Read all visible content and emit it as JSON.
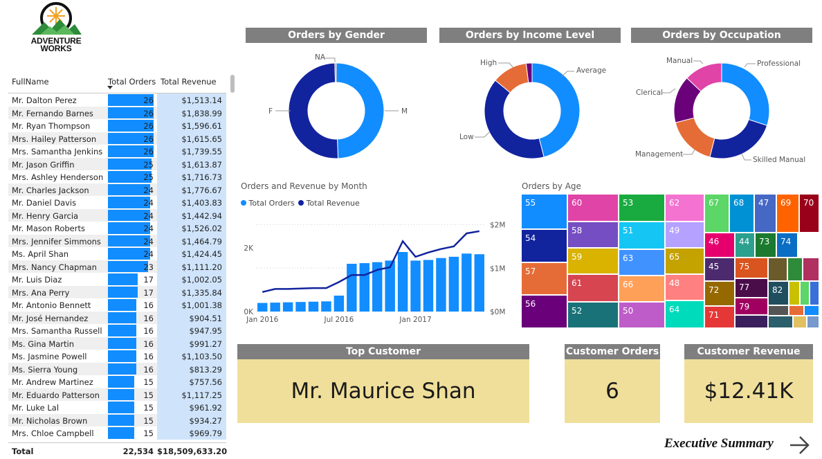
{
  "logo": {
    "line1": "ADVENTURE",
    "line2": "WORKS"
  },
  "table": {
    "headers": {
      "name": "FullName",
      "orders": "Total Orders",
      "revenue": "Total Revenue"
    },
    "max_orders": 26,
    "rows": [
      {
        "name": "Mr. Dalton Perez",
        "orders": 26,
        "revenue": "$1,513.14"
      },
      {
        "name": "Mr. Fernando Barnes",
        "orders": 26,
        "revenue": "$1,838.99"
      },
      {
        "name": "Mr. Ryan Thompson",
        "orders": 26,
        "revenue": "$1,596.61"
      },
      {
        "name": "Mrs. Hailey Patterson",
        "orders": 26,
        "revenue": "$1,615.65"
      },
      {
        "name": "Mrs. Samantha Jenkins",
        "orders": 26,
        "revenue": "$1,739.55"
      },
      {
        "name": "Mr. Jason Griffin",
        "orders": 25,
        "revenue": "$1,613.87"
      },
      {
        "name": "Mrs. Ashley Henderson",
        "orders": 25,
        "revenue": "$1,716.73"
      },
      {
        "name": "Mr. Charles Jackson",
        "orders": 24,
        "revenue": "$1,776.67"
      },
      {
        "name": "Mr. Daniel Davis",
        "orders": 24,
        "revenue": "$1,403.83"
      },
      {
        "name": "Mr. Henry Garcia",
        "orders": 24,
        "revenue": "$1,442.94"
      },
      {
        "name": "Mr. Mason Roberts",
        "orders": 24,
        "revenue": "$1,526.02"
      },
      {
        "name": "Mrs. Jennifer Simmons",
        "orders": 24,
        "revenue": "$1,464.79"
      },
      {
        "name": "Ms. April Shan",
        "orders": 24,
        "revenue": "$1,424.45"
      },
      {
        "name": "Mrs. Nancy Chapman",
        "orders": 23,
        "revenue": "$1,111.20"
      },
      {
        "name": "Mr. Luis Diaz",
        "orders": 17,
        "revenue": "$1,002.05"
      },
      {
        "name": "Mrs. Ana Perry",
        "orders": 17,
        "revenue": "$1,335.84"
      },
      {
        "name": "Mr. Antonio Bennett",
        "orders": 16,
        "revenue": "$1,001.38"
      },
      {
        "name": "Mr. José Hernandez",
        "orders": 16,
        "revenue": "$904.51"
      },
      {
        "name": "Mrs. Samantha Russell",
        "orders": 16,
        "revenue": "$947.95"
      },
      {
        "name": "Ms. Gina Martin",
        "orders": 16,
        "revenue": "$991.27"
      },
      {
        "name": "Ms. Jasmine Powell",
        "orders": 16,
        "revenue": "$1,103.50"
      },
      {
        "name": "Ms. Sierra Young",
        "orders": 16,
        "revenue": "$813.29"
      },
      {
        "name": "Mr. Andrew Martinez",
        "orders": 15,
        "revenue": "$757.56"
      },
      {
        "name": "Mr. Eduardo Patterson",
        "orders": 15,
        "revenue": "$1,117.25"
      },
      {
        "name": "Mr. Luke Lal",
        "orders": 15,
        "revenue": "$961.92"
      },
      {
        "name": "Mr. Nicholas Brown",
        "orders": 15,
        "revenue": "$934.27"
      },
      {
        "name": "Mrs. Chloe Campbell",
        "orders": 15,
        "revenue": "$969.79"
      }
    ],
    "total": {
      "label": "Total",
      "orders": "22,534",
      "revenue": "$18,509,633.20"
    }
  },
  "gender": {
    "title": "Orders by Gender",
    "labels": {
      "na": "NA",
      "f": "F",
      "m": "M"
    }
  },
  "income": {
    "title": "Orders by Income Level",
    "labels": {
      "high": "High",
      "average": "Average",
      "low": "Low"
    }
  },
  "occupation": {
    "title": "Orders by Occupation",
    "labels": {
      "manual": "Manual",
      "professional": "Professional",
      "clerical": "Clerical",
      "management": "Management",
      "skilled": "Skilled Manual"
    }
  },
  "colors": {
    "primary": "#118dff",
    "navy": "#12239e",
    "orange": "#e66c37",
    "purple": "#6b007b",
    "pink": "#e044a7",
    "red": "#d64550"
  },
  "chart_data": [
    {
      "type": "pie",
      "title": "Orders by Gender",
      "donut": true,
      "slices": [
        {
          "label": "M",
          "value": 49.4,
          "color": "#118dff"
        },
        {
          "label": "F",
          "value": 50.1,
          "color": "#12239e"
        },
        {
          "label": "NA",
          "value": 0.5,
          "color": "#e66c37"
        }
      ]
    },
    {
      "type": "pie",
      "title": "Orders by Income Level",
      "donut": true,
      "slices": [
        {
          "label": "Average",
          "value": 46,
          "color": "#118dff"
        },
        {
          "label": "Low",
          "value": 40,
          "color": "#12239e"
        },
        {
          "label": "High",
          "value": 12,
          "color": "#e66c37"
        },
        {
          "label": "",
          "value": 2,
          "color": "#6b007b"
        }
      ]
    },
    {
      "type": "pie",
      "title": "Orders by Occupation",
      "donut": true,
      "slices": [
        {
          "label": "Professional",
          "value": 30,
          "color": "#118dff"
        },
        {
          "label": "Skilled Manual",
          "value": 24,
          "color": "#12239e"
        },
        {
          "label": "Management",
          "value": 17,
          "color": "#e66c37"
        },
        {
          "label": "Clerical",
          "value": 16,
          "color": "#6b007b"
        },
        {
          "label": "Manual",
          "value": 13,
          "color": "#e044a7"
        }
      ]
    },
    {
      "type": "bar",
      "title": "Orders and Revenue by Month",
      "legend": [
        "Total Orders",
        "Total Revenue"
      ],
      "x_ticks": [
        "Jan 2016",
        "Jul 2016",
        "Jan 2017"
      ],
      "y_left_ticks": [
        "0K",
        "2K"
      ],
      "y_right_ticks": [
        "$0M",
        "$1M",
        "$2M"
      ],
      "y_left_range": [
        0,
        3000
      ],
      "y_right_range": [
        0,
        2200000
      ],
      "orders": [
        270,
        280,
        290,
        300,
        310,
        320,
        500,
        1500,
        1520,
        1550,
        1600,
        1870,
        1600,
        1620,
        1680,
        1720,
        1820,
        1800
      ],
      "revenue": [
        450000,
        520000,
        520000,
        530000,
        540000,
        540000,
        680000,
        840000,
        840000,
        960000,
        1020000,
        1620000,
        1260000,
        1360000,
        1440000,
        1500000,
        1800000,
        1850000
      ]
    },
    {
      "type": "heatmap",
      "title": "Orders by Age",
      "cells": [
        {
          "label": "55",
          "color": "#118dff"
        },
        {
          "label": "54",
          "color": "#12239e"
        },
        {
          "label": "57",
          "color": "#e66c37"
        },
        {
          "label": "56",
          "color": "#6b007b"
        },
        {
          "label": "60",
          "color": "#e044a7"
        },
        {
          "label": "58",
          "color": "#744ec2"
        },
        {
          "label": "59",
          "color": "#d9b300"
        },
        {
          "label": "61",
          "color": "#d64550"
        },
        {
          "label": "52",
          "color": "#197278"
        },
        {
          "label": "53",
          "color": "#1aab40"
        },
        {
          "label": "51",
          "color": "#15c6f4"
        },
        {
          "label": "63",
          "color": "#4092ff"
        },
        {
          "label": "66",
          "color": "#ffa058"
        },
        {
          "label": "50",
          "color": "#be5dc9"
        },
        {
          "label": "62",
          "color": "#f472d0"
        },
        {
          "label": "49",
          "color": "#b5a1ff"
        },
        {
          "label": "65",
          "color": "#c4a200"
        },
        {
          "label": "48",
          "color": "#ff8080"
        },
        {
          "label": "64",
          "color": "#00dbbc"
        },
        {
          "label": "67",
          "color": "#5bd667"
        },
        {
          "label": "68",
          "color": "#0091d5"
        },
        {
          "label": "47",
          "color": "#4668c5"
        },
        {
          "label": "69",
          "color": "#ff6300"
        },
        {
          "label": "70",
          "color": "#99001a"
        },
        {
          "label": "46",
          "color": "#e5006e"
        },
        {
          "label": "44",
          "color": "#2ba08f"
        },
        {
          "label": "73",
          "color": "#1b7a2f"
        },
        {
          "label": "74",
          "color": "#0a6ec4"
        },
        {
          "label": "45",
          "color": "#4b2b6e"
        },
        {
          "label": "75",
          "color": "#d9541f"
        },
        {
          "label": "72",
          "color": "#966800"
        },
        {
          "label": "77",
          "color": "#4a0d4a"
        },
        {
          "label": "82",
          "color": "#1f4e5f"
        },
        {
          "label": "71",
          "color": "#e63737"
        },
        {
          "label": "79",
          "color": "#a00060"
        }
      ]
    }
  ],
  "cards": {
    "top_customer": {
      "title": "Top Customer",
      "value": "Mr. Maurice Shan"
    },
    "customer_orders": {
      "title": "Customer Orders",
      "value": "6"
    },
    "customer_revenue": {
      "title": "Customer Revenue",
      "value": "$12.41K"
    }
  },
  "nav": {
    "executive_summary": "Executive Summary"
  }
}
